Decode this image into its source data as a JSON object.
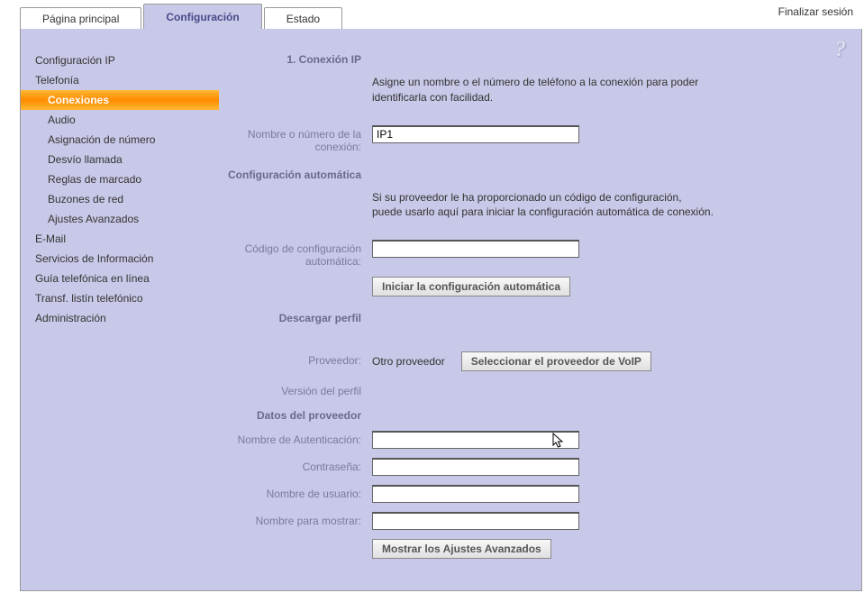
{
  "header": {
    "tabs": {
      "home": "Página principal",
      "config": "Configuración",
      "status": "Estado"
    },
    "logout": "Finalizar sesión"
  },
  "sidebar": {
    "ip_config": "Configuración IP",
    "telephony": "Telefonía",
    "connections": "Conexiones",
    "audio": "Audio",
    "number_assignment": "Asignación de número",
    "call_divert": "Desvío llamada",
    "dialing_rules": "Reglas de marcado",
    "network_mailboxes": "Buzones de red",
    "advanced_settings": "Ajustes Avanzados",
    "email": "E-Mail",
    "info_services": "Servicios de Información",
    "online_phonebook": "Guía telefónica en línea",
    "phonebook_transfer": "Transf. listín telefónico",
    "administration": "Administración"
  },
  "form": {
    "section1_title": "1. Conexión IP",
    "name_description": "Asigne un nombre o el número de teléfono a la conexión para poder identificarla con facilidad.",
    "name_label": "Nombre o número de la conexión:",
    "name_value": "IP1",
    "auto_config_section": "Configuración automática",
    "auto_config_description": "Si su proveedor le ha proporcionado un código de configuración, puede usarlo aquí para iniciar la configuración automática de conexión.",
    "auto_config_code_label": "Código de configuración automática:",
    "auto_config_code_value": "",
    "start_auto_config_button": "Iniciar la configuración automática",
    "download_profile_section": "Descargar perfil",
    "provider_label": "Proveedor:",
    "provider_value": "Otro proveedor",
    "select_voip_provider_button": "Seleccionar el proveedor de VoIP",
    "profile_version_label": "Versión del perfil",
    "profile_version_value": "",
    "provider_data_section": "Datos del proveedor",
    "auth_name_label": "Nombre de Autenticación:",
    "auth_name_value": "",
    "password_label": "Contraseña:",
    "password_value": "",
    "username_label": "Nombre de usuario:",
    "username_value": "",
    "display_name_label": "Nombre para mostrar:",
    "display_name_value": "",
    "show_advanced_button": "Mostrar los Ajustes Avanzados"
  }
}
